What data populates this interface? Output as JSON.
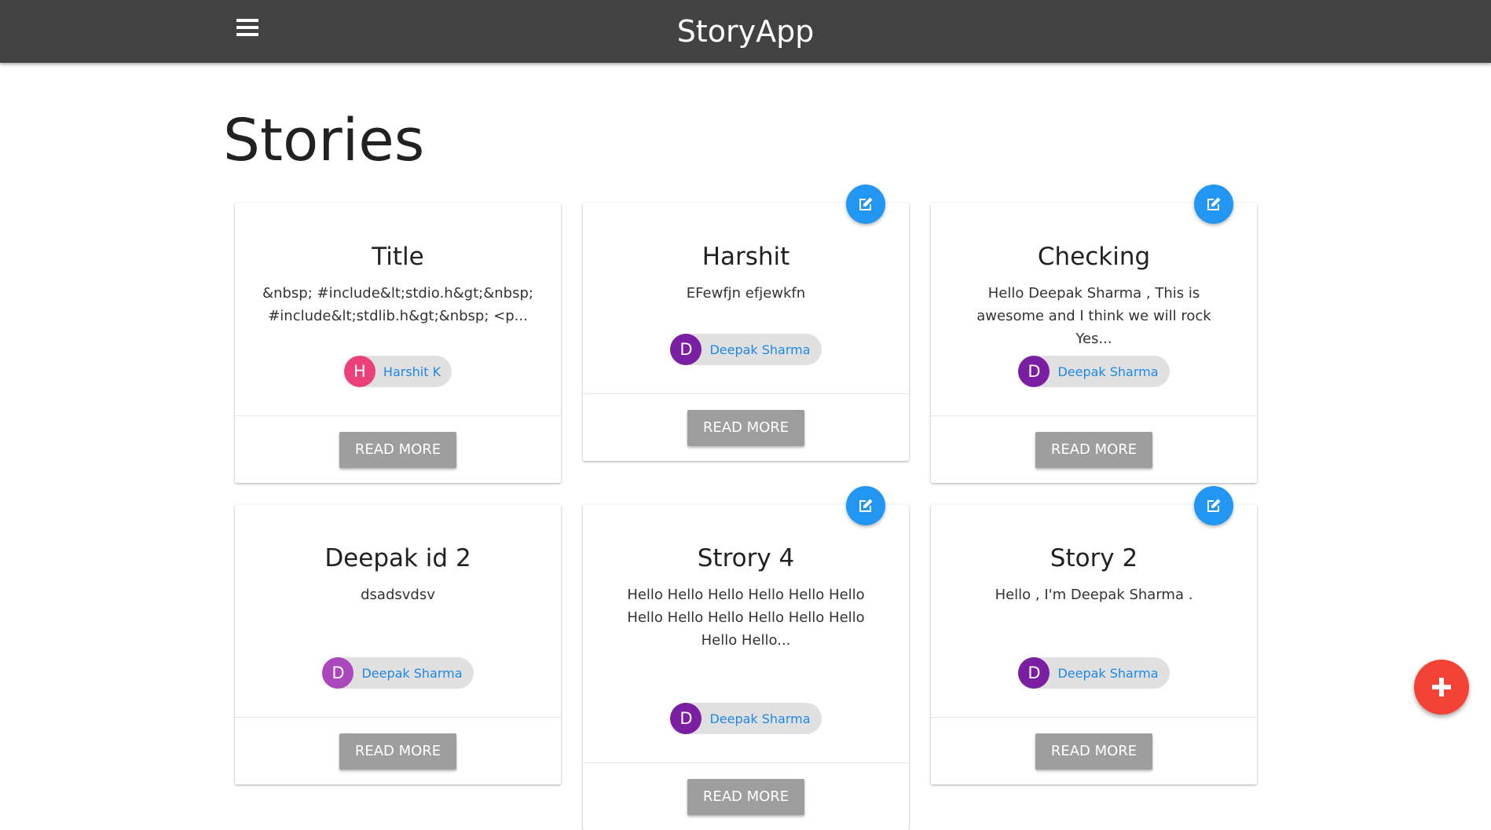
{
  "app": {
    "title": "StoryApp"
  },
  "page": {
    "heading": "Stories"
  },
  "icons": {
    "menu": "menu-icon",
    "edit": "edit-icon",
    "add": "add-icon"
  },
  "colors": {
    "appbar": "#424242",
    "edit_button": "#2196f3",
    "fab": "#f44336",
    "read_more_button": "#9e9e9e",
    "author_link": "#1e88e5"
  },
  "stories": [
    {
      "title": "Title",
      "excerpt": "&nbsp; #include&lt;stdio.h&gt;&nbsp; #include&lt;stdlib.h&gt;&nbsp; <p...",
      "author_initial": "H",
      "author_name": "Harshit K",
      "avatar_color": "#ec407a",
      "editable": false,
      "action_label": "READ MORE"
    },
    {
      "title": "Harshit",
      "excerpt": "EFewfjn efjewkfn",
      "author_initial": "D",
      "author_name": "Deepak Sharma",
      "avatar_color": "#7b1fa2",
      "editable": true,
      "action_label": "READ MORE"
    },
    {
      "title": "Checking",
      "excerpt": "Hello Deepak Sharma , This is awesome and I think we will rock Yes...",
      "author_initial": "D",
      "author_name": "Deepak Sharma",
      "avatar_color": "#7b1fa2",
      "editable": true,
      "action_label": "READ MORE"
    },
    {
      "title": "Deepak id 2",
      "excerpt": "dsadsvdsv",
      "author_initial": "D",
      "author_name": "Deepak Sharma",
      "avatar_color": "#ab47bc",
      "editable": false,
      "action_label": "READ MORE"
    },
    {
      "title": "Strory 4",
      "excerpt": "Hello Hello Hello Hello Hello Hello Hello Hello Hello Hello Hello Hello Hello Hello...",
      "author_initial": "D",
      "author_name": "Deepak Sharma",
      "avatar_color": "#7b1fa2",
      "editable": true,
      "action_label": "READ MORE"
    },
    {
      "title": "Story 2",
      "excerpt": "Hello , I'm Deepak Sharma .",
      "author_initial": "D",
      "author_name": "Deepak Sharma",
      "avatar_color": "#7b1fa2",
      "editable": true,
      "action_label": "READ MORE"
    }
  ]
}
